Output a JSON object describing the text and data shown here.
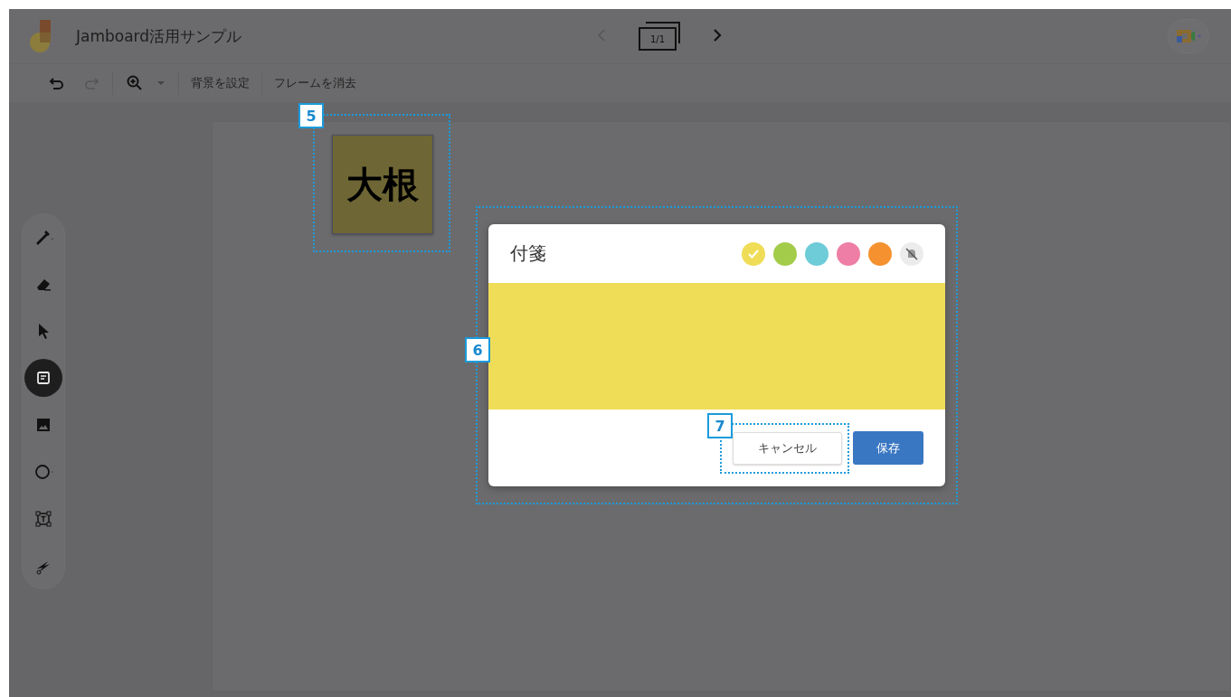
{
  "header": {
    "title": "Jamboard活用サンプル",
    "frame_counter": "1/1"
  },
  "toolbar": {
    "actions": [
      {
        "label": "背景を設定"
      },
      {
        "label": "フレームを消去"
      }
    ]
  },
  "tools": [
    {
      "kind": "pen",
      "selected": false
    },
    {
      "kind": "eraser",
      "selected": false
    },
    {
      "kind": "select",
      "selected": false
    },
    {
      "kind": "note",
      "selected": true
    },
    {
      "kind": "image",
      "selected": false
    },
    {
      "kind": "shape",
      "selected": false
    },
    {
      "kind": "textbox",
      "selected": false
    },
    {
      "kind": "laser",
      "selected": false
    }
  ],
  "canvas": {
    "sticky_note": {
      "text": "大根"
    }
  },
  "dialog": {
    "title": "付箋",
    "swatches": [
      {
        "color": "#efdd58",
        "selected": true
      },
      {
        "color": "#a3cc4a",
        "selected": false
      },
      {
        "color": "#6ecbd8",
        "selected": false
      },
      {
        "color": "#ee7ea5",
        "selected": false
      },
      {
        "color": "#f5922f",
        "selected": false
      }
    ],
    "cancel": "キャンセル",
    "save": "保存"
  },
  "callouts": [
    {
      "label": "5"
    },
    {
      "label": "6"
    },
    {
      "label": "7"
    }
  ]
}
